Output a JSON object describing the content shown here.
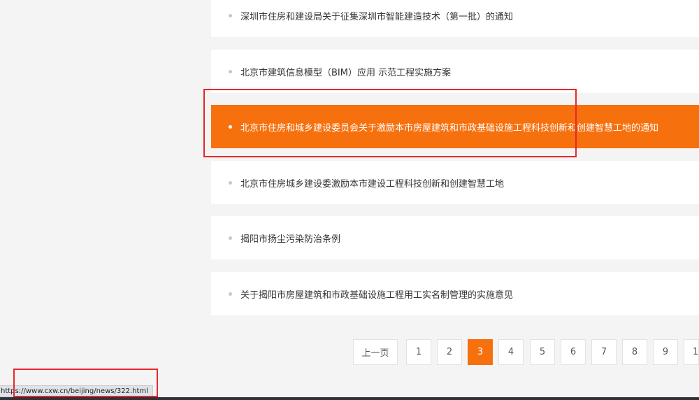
{
  "news_list": [
    {
      "title": "深圳市住房和建设局关于征集深圳市智能建造技术（第一批）的通知",
      "active": false
    },
    {
      "title": "北京市建筑信息模型（BIM）应用 示范工程实施方案",
      "active": false
    },
    {
      "title": "北京市住房和城乡建设委员会关于激励本市房屋建筑和市政基础设施工程科技创新和创建智慧工地的通知",
      "active": true
    },
    {
      "title": "北京市住房城乡建设委激励本市建设工程科技创新和创建智慧工地",
      "active": false
    },
    {
      "title": "揭阳市扬尘污染防治条例",
      "active": false
    },
    {
      "title": "关于揭阳市房屋建筑和市政基础设施工程用工实名制管理的实施意见",
      "active": false
    }
  ],
  "pagination": {
    "prev_label": "上一页",
    "pages": [
      "1",
      "2",
      "3",
      "4",
      "5",
      "6",
      "7",
      "8",
      "9",
      "1"
    ],
    "current": "3"
  },
  "status_bar": {
    "url": "https://www.cxw.cn/beijing/news/322.html"
  },
  "colors": {
    "accent": "#f7700e",
    "annotation": "#e8262b",
    "background": "#f4f4f4"
  }
}
